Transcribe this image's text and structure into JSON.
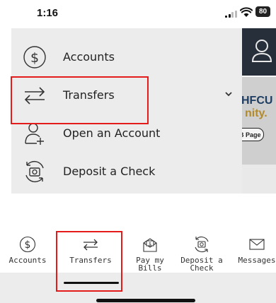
{
  "status_bar": {
    "time": "1:16",
    "battery": "80"
  },
  "background_app": {
    "banner_line1": "HFCU",
    "banner_line2": "nity.",
    "banner_button": "FB Page"
  },
  "menu": {
    "items": [
      {
        "label": "Accounts",
        "icon": "dollar-circle-icon"
      },
      {
        "label": "Transfers",
        "icon": "transfer-arrows-icon",
        "expandable": true
      },
      {
        "label": "Open an Account",
        "icon": "add-person-icon"
      },
      {
        "label": "Deposit a Check",
        "icon": "deposit-camera-icon"
      }
    ],
    "highlighted": "Transfers"
  },
  "tab_bar": {
    "tabs": [
      {
        "label": "Accounts",
        "icon": "dollar-circle-icon"
      },
      {
        "label": "Transfers",
        "icon": "transfer-arrows-icon"
      },
      {
        "label": "Pay my Bills",
        "line1": "Pay my",
        "line2": "Bills",
        "icon": "bill-envelope-icon"
      },
      {
        "label": "Deposit a Check",
        "line1": "Deposit a",
        "line2": "Check",
        "icon": "deposit-camera-icon"
      },
      {
        "label": "Messages",
        "icon": "mail-icon"
      }
    ],
    "selected": "Transfers"
  },
  "colors": {
    "highlight": "#e31b1b",
    "menu_bg": "#ececec",
    "header_dark": "#27303a"
  }
}
